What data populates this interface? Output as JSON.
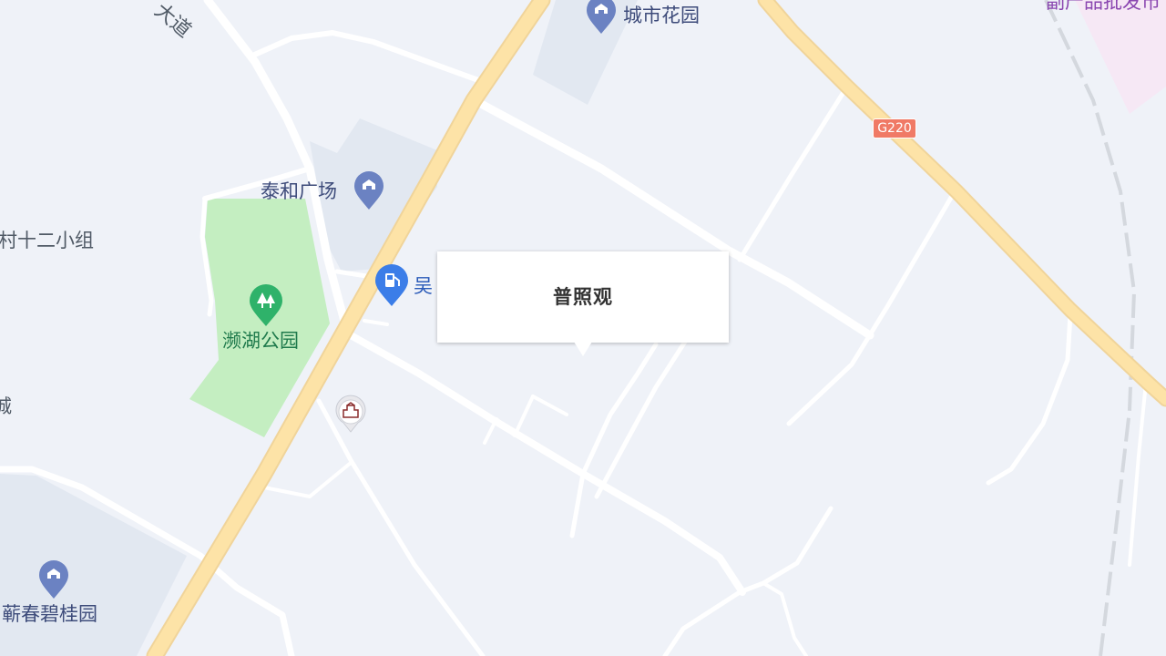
{
  "map": {
    "labels": {
      "road_top": "大道",
      "city_garden": "城市花园",
      "wholesale": "副产品批发市",
      "taihe_plaza": "泰和广场",
      "village_group": "村十二小组",
      "gas_station": "吴",
      "lake_park": "濒湖公园",
      "left_city": "城",
      "biguiyuan": "蕲春碧桂园"
    },
    "route_shield": "G220",
    "popup": {
      "title": "普照观"
    },
    "icons": {
      "city_garden": "building-pin-icon",
      "taihe_plaza": "building-pin-icon",
      "biguiyuan": "building-pin-icon",
      "gas_station": "gas-station-pin-icon",
      "lake_park": "park-tree-pin-icon",
      "temple": "temple-marker-icon"
    },
    "colors": {
      "background": "#eff2f8",
      "highway": "#fde3a7",
      "road": "#ffffff",
      "park": "#c4eec1",
      "block": "#e2e8f1",
      "shield": "#f07a66",
      "pin_building": "#6b82c2",
      "pin_gas": "#3b7de8",
      "pin_park": "#2fb26a"
    }
  }
}
